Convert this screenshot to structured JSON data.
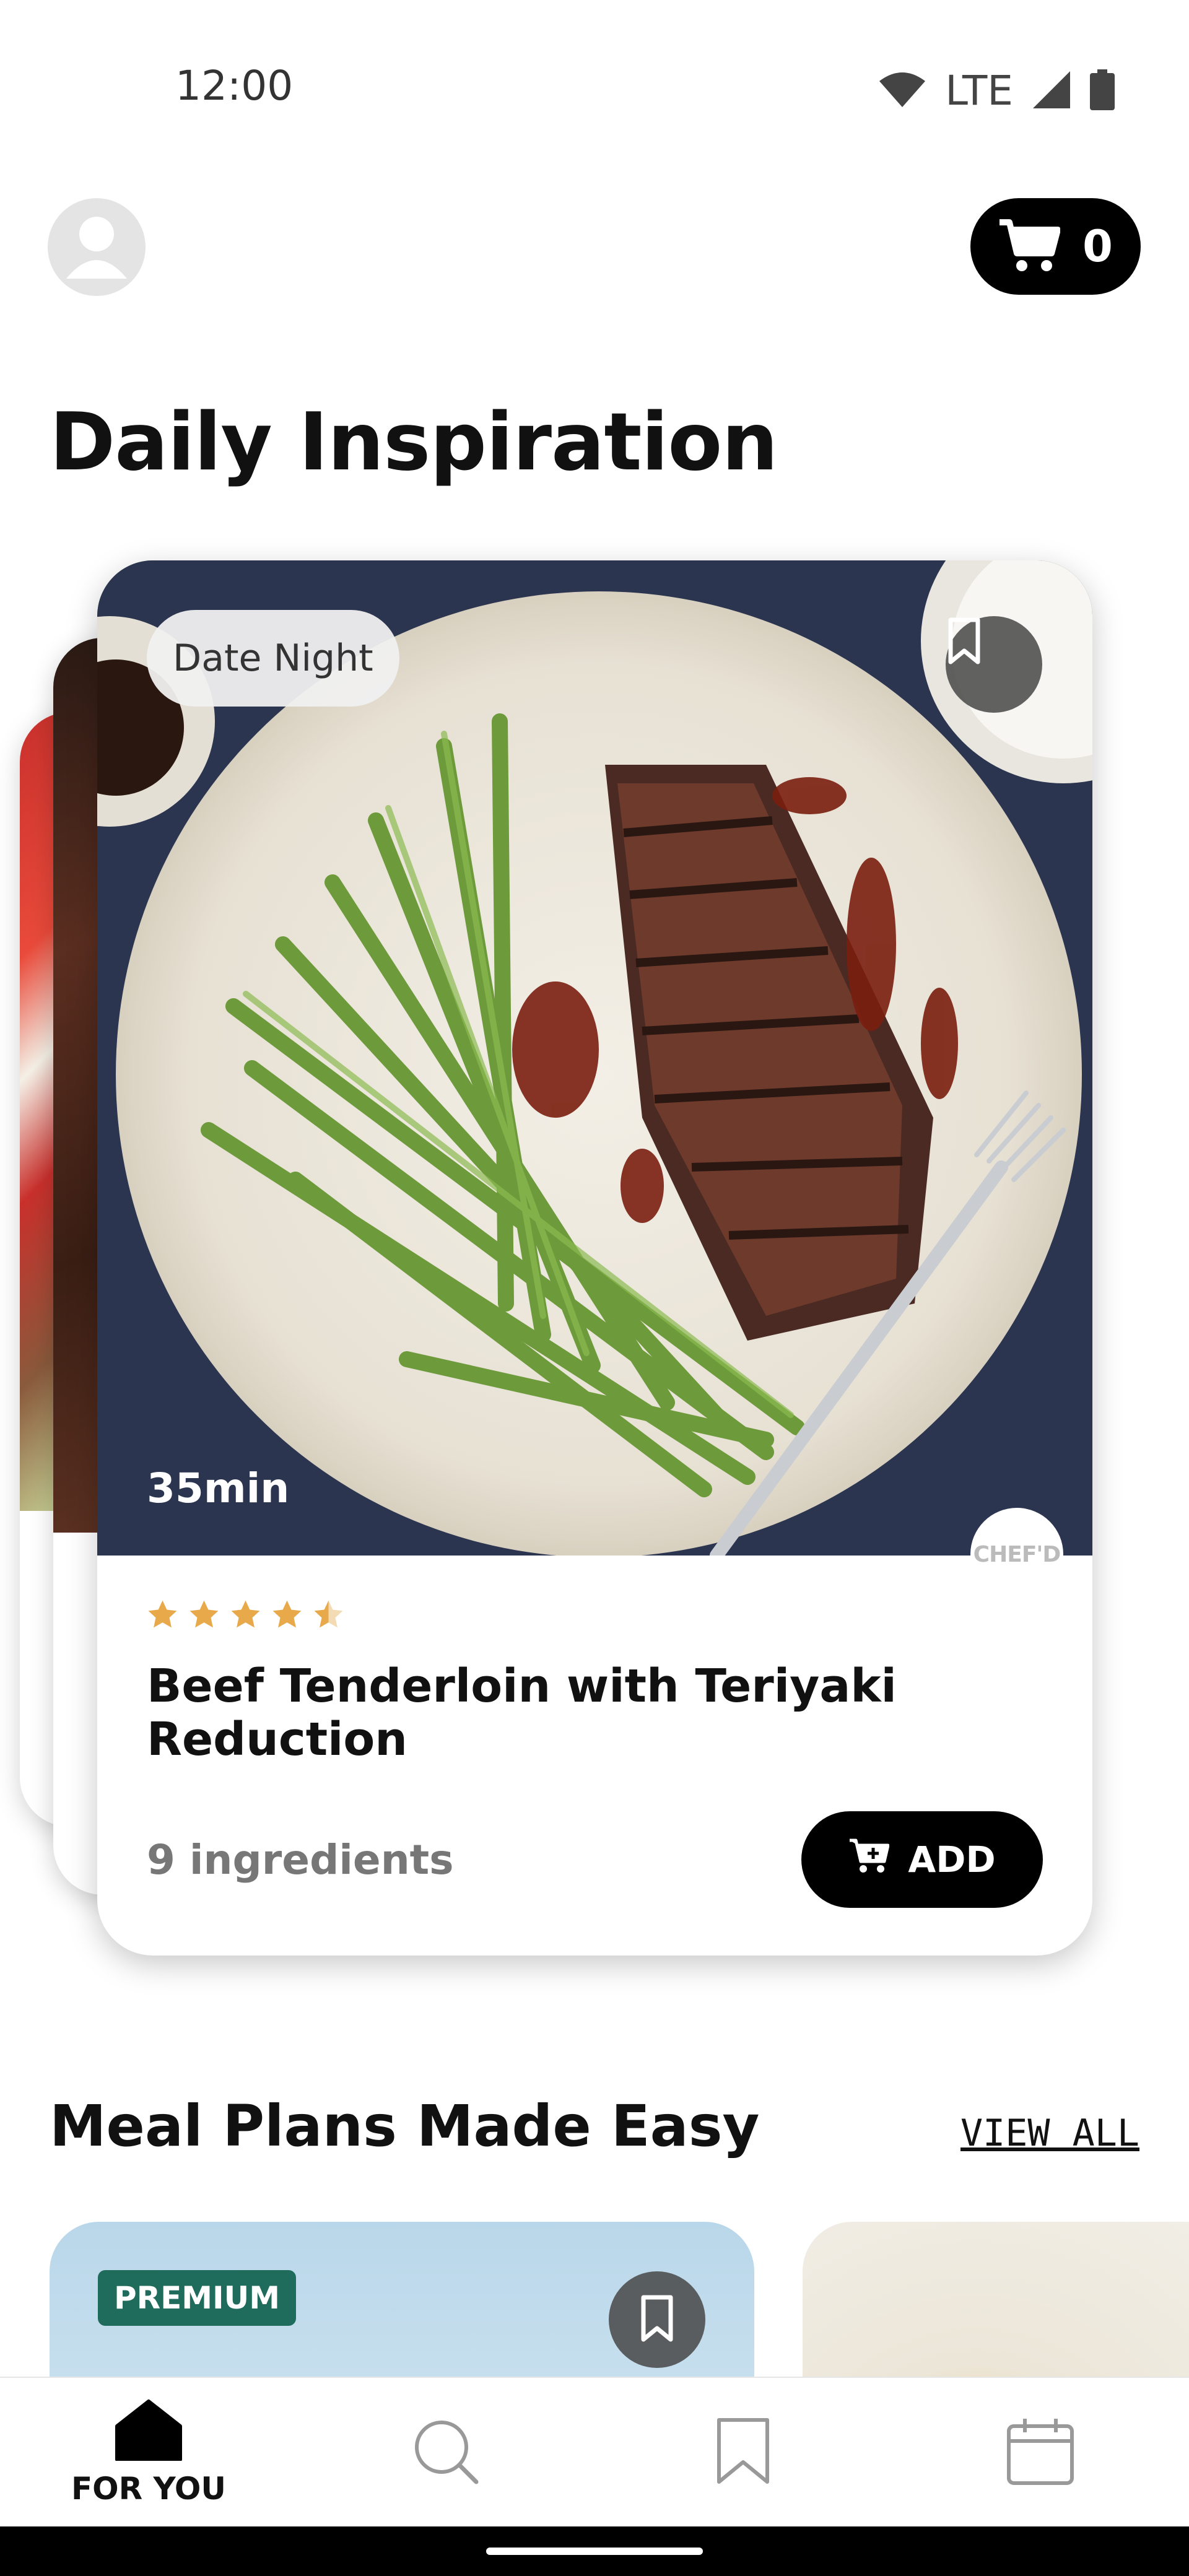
{
  "status_bar": {
    "time": "12:00",
    "network": "LTE"
  },
  "header": {
    "cart_count": "0"
  },
  "daily_inspiration": {
    "title": "Daily Inspiration",
    "card": {
      "tag": "Date Night",
      "time": "35min",
      "rating": 4.5,
      "brand": "CHEF'D",
      "title": "Beef Tenderloin with Teriyaki Reduction",
      "ingredients": "9 ingredients",
      "add_label": "ADD"
    }
  },
  "meal_plans": {
    "title": "Meal Plans Made Easy",
    "view_all": "VIEW ALL",
    "cards": [
      {
        "badge": "PREMIUM"
      }
    ]
  },
  "bottom_nav": {
    "items": [
      {
        "label": "FOR YOU",
        "icon": "home-icon",
        "active": true
      },
      {
        "label": "",
        "icon": "search-icon"
      },
      {
        "label": "",
        "icon": "bookmark-icon"
      },
      {
        "label": "",
        "icon": "calendar-icon"
      }
    ]
  },
  "colors": {
    "accent": "#000000",
    "star": "#e8a94a",
    "premium": "#1f6b5c"
  }
}
